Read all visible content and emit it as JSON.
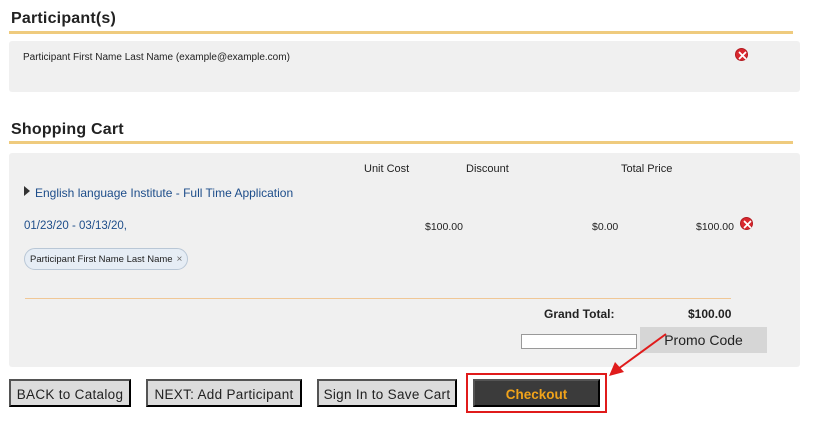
{
  "participants": {
    "title": "Participant(s)",
    "entry": "Participant First Name Last Name (example@example.com)"
  },
  "cart": {
    "title": "Shopping Cart",
    "columns": {
      "unit_cost": "Unit Cost",
      "discount": "Discount",
      "total_price": "Total Price"
    },
    "item": {
      "title": "English language Institute - Full Time Application",
      "dates": "01/23/20 - 03/13/20,",
      "unit_cost": "$100.00",
      "discount": "$0.00",
      "total_price": "$100.00",
      "participant_chip": "Participant First Name Last Name",
      "chip_remove": "×"
    },
    "grand_total_label": "Grand Total:",
    "grand_total_value": "$100.00",
    "promo_input_value": "",
    "promo_button": "Promo Code"
  },
  "actions": {
    "back": "BACK to Catalog",
    "next": "NEXT: Add Participant",
    "sign_in": "Sign In to Save Cart",
    "checkout": "Checkout"
  },
  "icons": {
    "remove": "remove-circle-icon",
    "expand": "caret-right-icon",
    "annotation": "annotation-arrow"
  },
  "colors": {
    "rule": "#efcb7e",
    "link": "#1d4d8a",
    "remove": "#d9272e",
    "checkout_bg": "#3b3b3b",
    "checkout_text": "#f1a31a",
    "highlight": "#e01b1b"
  }
}
